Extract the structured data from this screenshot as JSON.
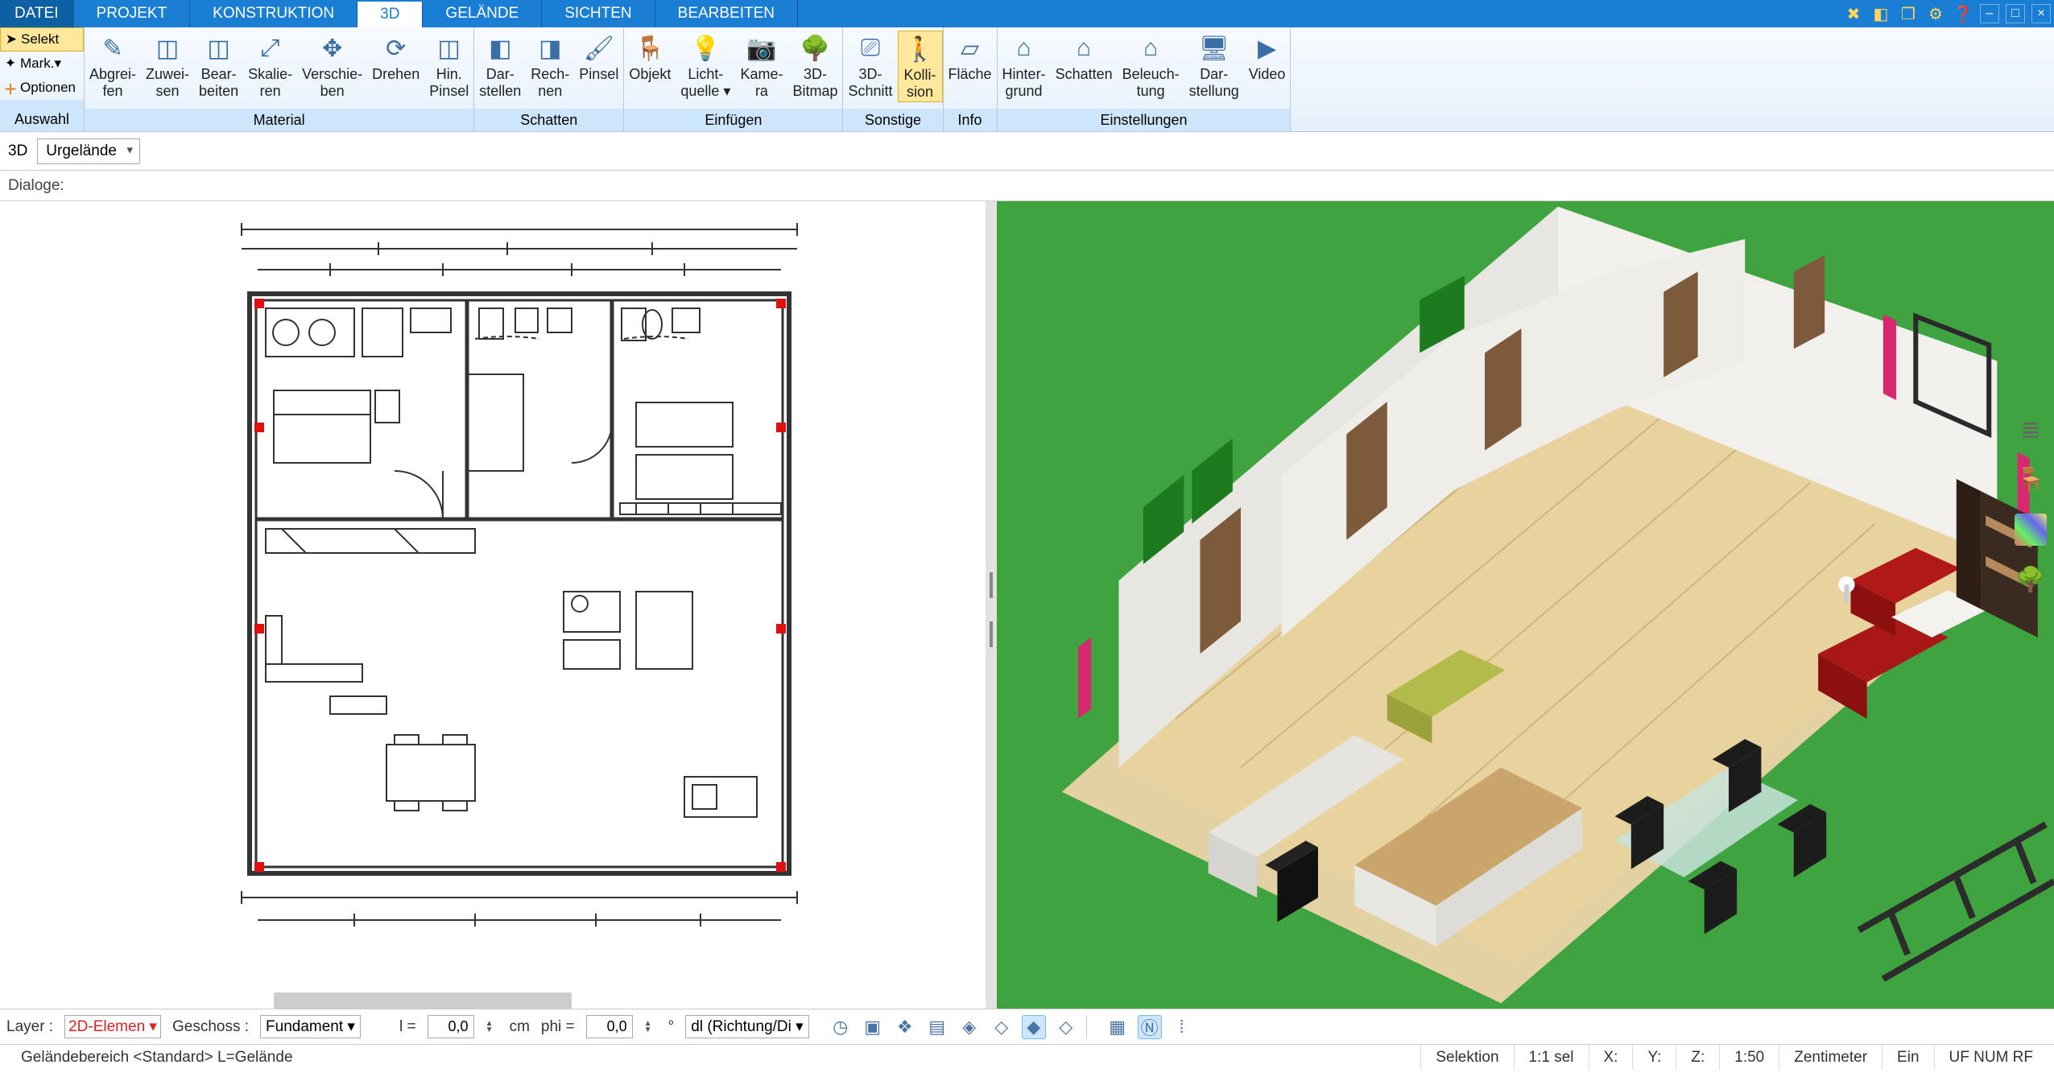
{
  "menu": {
    "file": "DATEI",
    "tabs": [
      "PROJEKT",
      "KONSTRUKTION",
      "3D",
      "GELÄNDE",
      "SICHTEN",
      "BEARBEITEN"
    ],
    "active": "3D"
  },
  "ribbon": {
    "left": {
      "select": "Selekt",
      "mark": "Mark.",
      "options": "Optionen",
      "group": "Auswahl"
    },
    "groups": [
      {
        "name": "Material",
        "buttons": [
          {
            "id": "abgreifen",
            "label": "Abgrei-\nfen",
            "icon": "✎"
          },
          {
            "id": "zuweisen",
            "label": "Zuwei-\nsen",
            "icon": "◫"
          },
          {
            "id": "bearbeiten",
            "label": "Bear-\nbeiten",
            "icon": "◫"
          },
          {
            "id": "skalieren",
            "label": "Skalie-\nren",
            "icon": "⤢"
          },
          {
            "id": "verschieben",
            "label": "Verschie-\nben",
            "icon": "✥"
          },
          {
            "id": "drehen",
            "label": "Drehen",
            "icon": "⟳"
          },
          {
            "id": "hinpinsel",
            "label": "Hin.\nPinsel",
            "icon": "◫"
          }
        ]
      },
      {
        "name": "Schatten",
        "buttons": [
          {
            "id": "darstellen",
            "label": "Dar-\nstellen",
            "icon": "◧"
          },
          {
            "id": "rechnen",
            "label": "Rech-\nnen",
            "icon": "◨"
          },
          {
            "id": "pinsel",
            "label": "Pinsel",
            "icon": "🖌"
          }
        ]
      },
      {
        "name": "Einfügen",
        "buttons": [
          {
            "id": "objekt",
            "label": "Objekt",
            "icon": "🪑"
          },
          {
            "id": "licht",
            "label": "Licht-\nquelle ▾",
            "icon": "💡"
          },
          {
            "id": "kamera",
            "label": "Kame-\nra",
            "icon": "📷"
          },
          {
            "id": "3dbitmap",
            "label": "3D-\nBitmap",
            "icon": "🌳"
          }
        ]
      },
      {
        "name": "Sonstige",
        "buttons": [
          {
            "id": "3dschnitt",
            "label": "3D-\nSchnitt",
            "icon": "⎚"
          },
          {
            "id": "kollision",
            "label": "Kolli-\nsion",
            "icon": "🚶",
            "active": true
          }
        ]
      },
      {
        "name": "Info",
        "buttons": [
          {
            "id": "flaeche",
            "label": "Fläche",
            "icon": "▱"
          }
        ]
      },
      {
        "name": "Einstellungen",
        "buttons": [
          {
            "id": "hintergrund",
            "label": "Hinter-\ngrund",
            "icon": "⌂"
          },
          {
            "id": "schatten2",
            "label": "Schatten",
            "icon": "⌂"
          },
          {
            "id": "beleuchtung",
            "label": "Beleuch-\ntung",
            "icon": "⌂"
          },
          {
            "id": "darstellung",
            "label": "Dar-\nstellung",
            "icon": "🖥"
          },
          {
            "id": "video",
            "label": "Video",
            "icon": "▶"
          }
        ]
      }
    ]
  },
  "subbar": {
    "mode": "3D",
    "terrain": "Urgelände"
  },
  "dialogbar": {
    "label": "Dialoge:"
  },
  "bottombar": {
    "layer_label": "Layer :",
    "layer_value": "2D-Elemen",
    "floor_label": "Geschoss :",
    "floor_value": "Fundament",
    "l_label": "l =",
    "l_value": "0,0",
    "l_unit": "cm",
    "phi_label": "phi =",
    "phi_value": "0,0",
    "dir_value": "dl (Richtung/Di"
  },
  "status": {
    "left": "Geländebereich <Standard> L=Gelände",
    "selection": "Selektion",
    "scale": "1:1 sel",
    "x": "X:",
    "y": "Y:",
    "z": "Z:",
    "ratio": "1:50",
    "unit": "Zentimeter",
    "ein": "Ein",
    "misc": "UF NUM RF"
  },
  "side_palette": [
    "≣",
    "🪑",
    "▦",
    "🌳"
  ]
}
